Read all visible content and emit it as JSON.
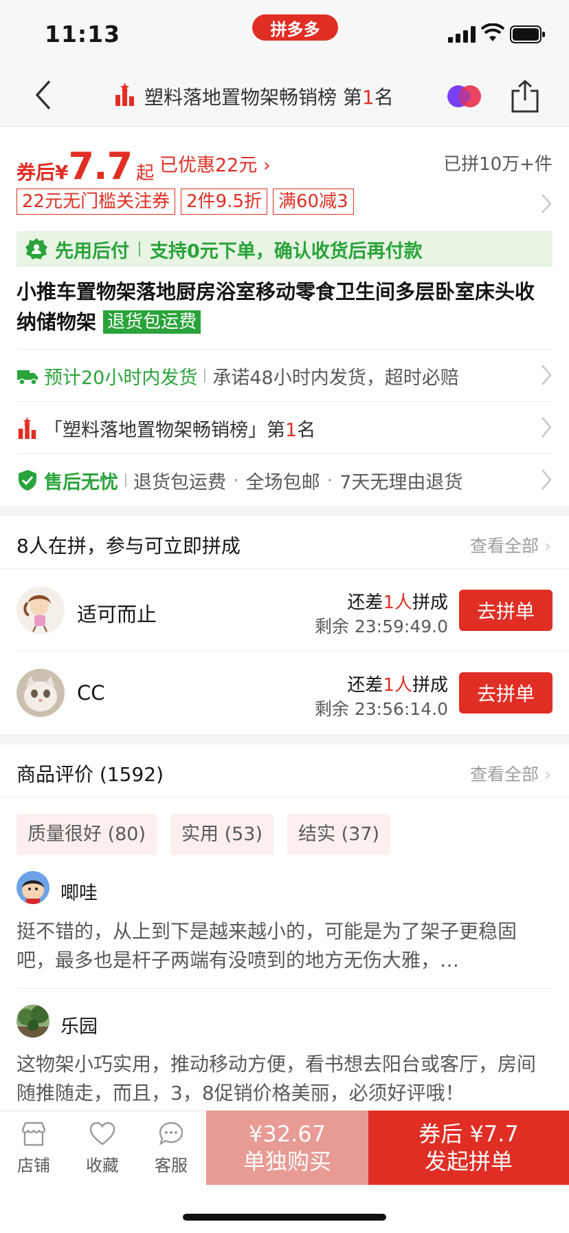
{
  "status_bar": {
    "time": "11:13",
    "app_pill": "拼多多"
  },
  "nav": {
    "title_prefix": "塑料落地置物架畅销榜 第",
    "title_rank": "1",
    "title_suffix": "名"
  },
  "price": {
    "prefix": "券后",
    "currency": "¥",
    "value": "7.7",
    "suffix": "起",
    "discount": "已优惠22元",
    "sold": "已拼10万+件"
  },
  "promo_tags": [
    "22元无门槛关注券",
    "2件9.5折",
    "满60减3"
  ],
  "credit": {
    "title": "先用后付",
    "text": "支持0元下单，确认收货后再付款"
  },
  "product": {
    "title": "小推车置物架落地厨房浴室移动零食卫生间多层卧室床头收纳储物架",
    "badge": "退货包运费"
  },
  "services": {
    "shipping_green": "预计20小时内发货",
    "shipping_gray": "承诺48小时内发货，超时必赔",
    "rank_prefix": "「塑料落地置物架畅销榜」第",
    "rank_num": "1",
    "rank_suffix": "名",
    "aftersale_green": "售后无忧",
    "aftersale_items": [
      "退货包运费",
      "全场包邮",
      "7天无理由退货"
    ]
  },
  "group": {
    "title": "8人在拼，参与可立即拼成",
    "view_all": "查看全部",
    "lack_prefix": "还差",
    "lack_num": "1人",
    "lack_suffix": "拼成",
    "join_label": "去拼单",
    "items": [
      {
        "name": "适可而止",
        "remain": "剩余 23:59:49.0"
      },
      {
        "name": "CC",
        "remain": "剩余 23:56:14.0"
      }
    ]
  },
  "reviews": {
    "title": "商品评价 (1592)",
    "view_all": "查看全部",
    "chips": [
      "质量很好 (80)",
      "实用 (53)",
      "结实 (37)"
    ],
    "items": [
      {
        "name": "唧哇",
        "text": "挺不错的，从上到下是越来越小的，可能是为了架子更稳固吧，最多也是杆子两端有没喷到的地方无伤大雅，…"
      },
      {
        "name": "乐园",
        "text": "这物架小巧实用，推动移动方便，看书想去阳台或客厅，房间随推随走，而且，3，8促销价格美丽，必须好评哦！"
      }
    ]
  },
  "bottom_bar": {
    "shop": "店铺",
    "favorite": "收藏",
    "service": "客服",
    "single_price": "¥32.67",
    "single_label": "单独购买",
    "group_price": "券后 ¥7.7",
    "group_label": "发起拼单"
  },
  "colors": {
    "brand_red": "#e02e24",
    "green": "#29a33a",
    "light_red": "#e89a94"
  }
}
